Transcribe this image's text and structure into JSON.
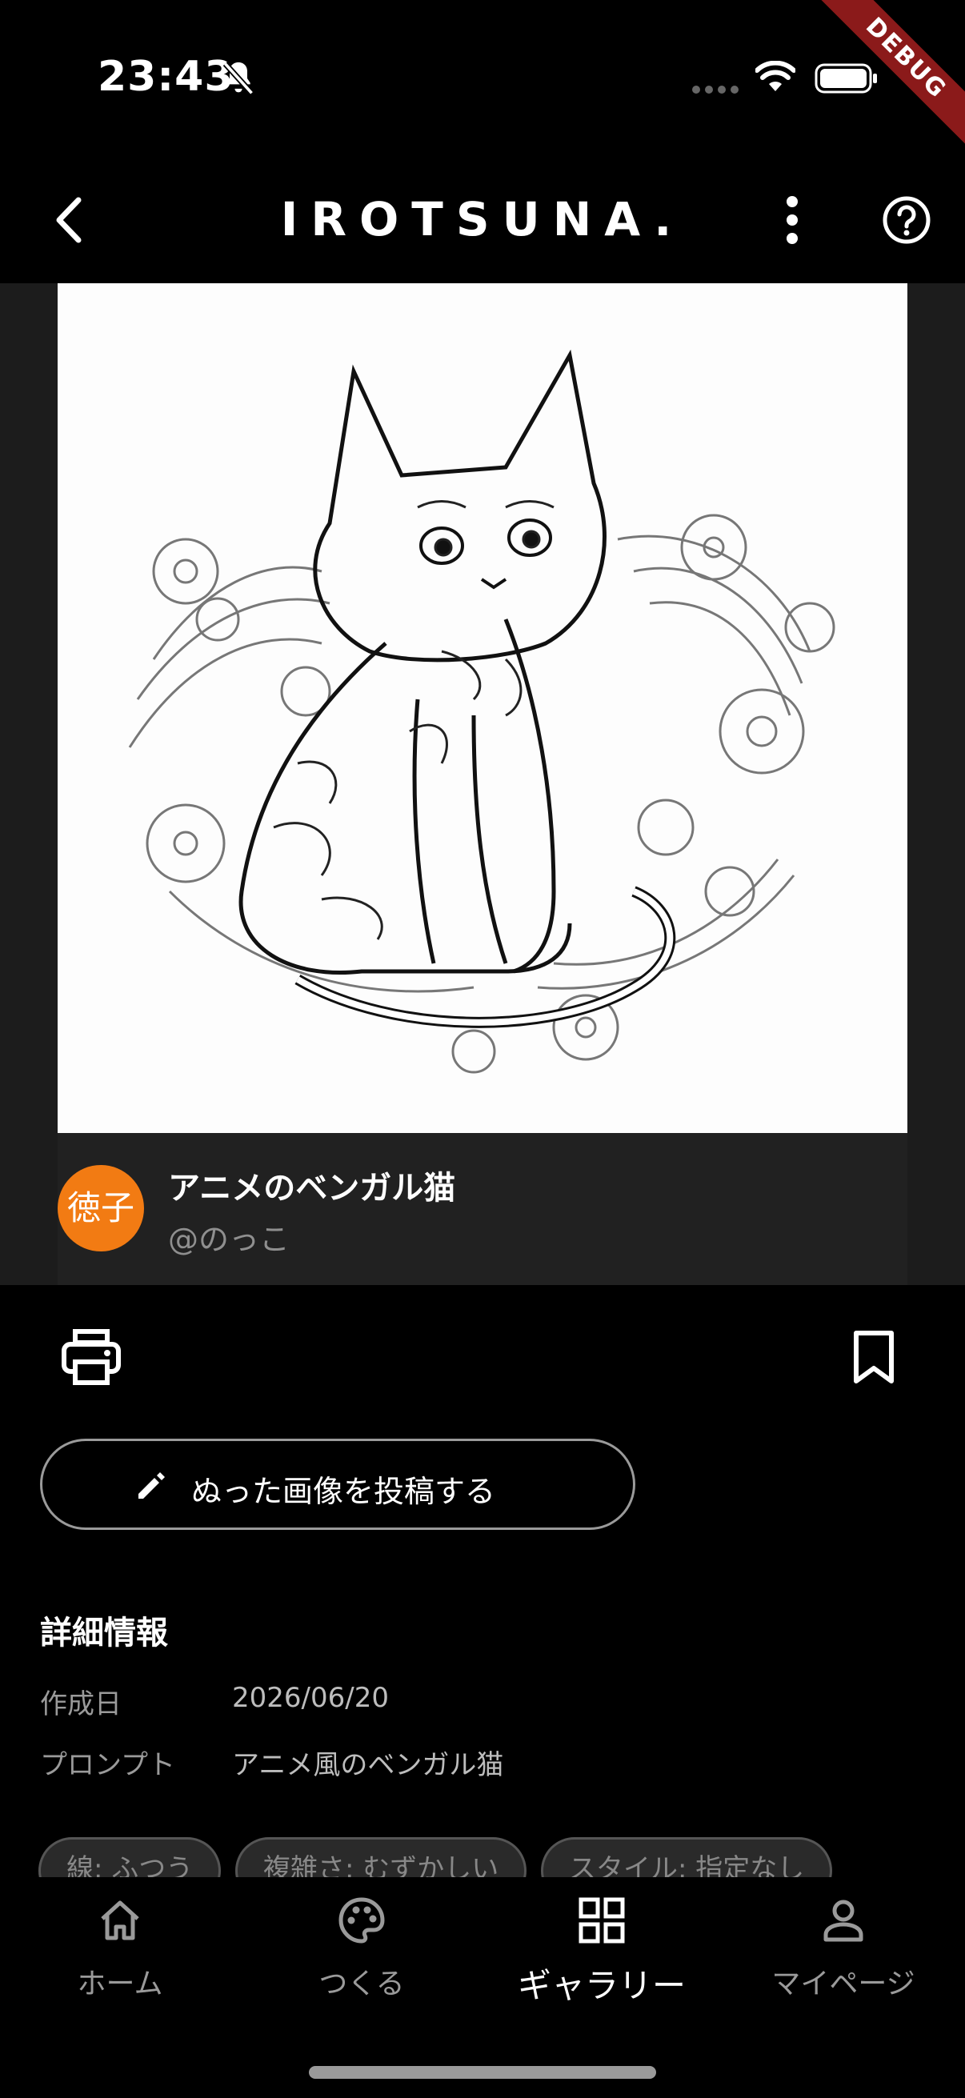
{
  "status": {
    "time": "23:43"
  },
  "debug_label": "DEBUG",
  "app_bar": {
    "brand": "IROTSUNA."
  },
  "artwork": {
    "title": "アニメのベンガル猫",
    "author": "@のっこ",
    "avatar_text": "徳子",
    "avatar_color": "#f27b13"
  },
  "actions": {
    "post_label": "ぬった画像を投稿する"
  },
  "details": {
    "heading": "詳細情報",
    "rows": [
      {
        "label": "作成日",
        "value": "2026/06/20"
      },
      {
        "label": "プロンプト",
        "value": "アニメ風のベンガル猫"
      }
    ]
  },
  "chips": [
    "線: ふつう",
    "複雑さ: むずかしい",
    "スタイル: 指定なし"
  ],
  "nav": {
    "items": [
      {
        "label": "ホーム",
        "icon": "home-icon"
      },
      {
        "label": "つくる",
        "icon": "palette-icon"
      },
      {
        "label": "ギャラリー",
        "icon": "grid-icon"
      },
      {
        "label": "マイページ",
        "icon": "person-icon"
      }
    ],
    "active_index": 2
  }
}
